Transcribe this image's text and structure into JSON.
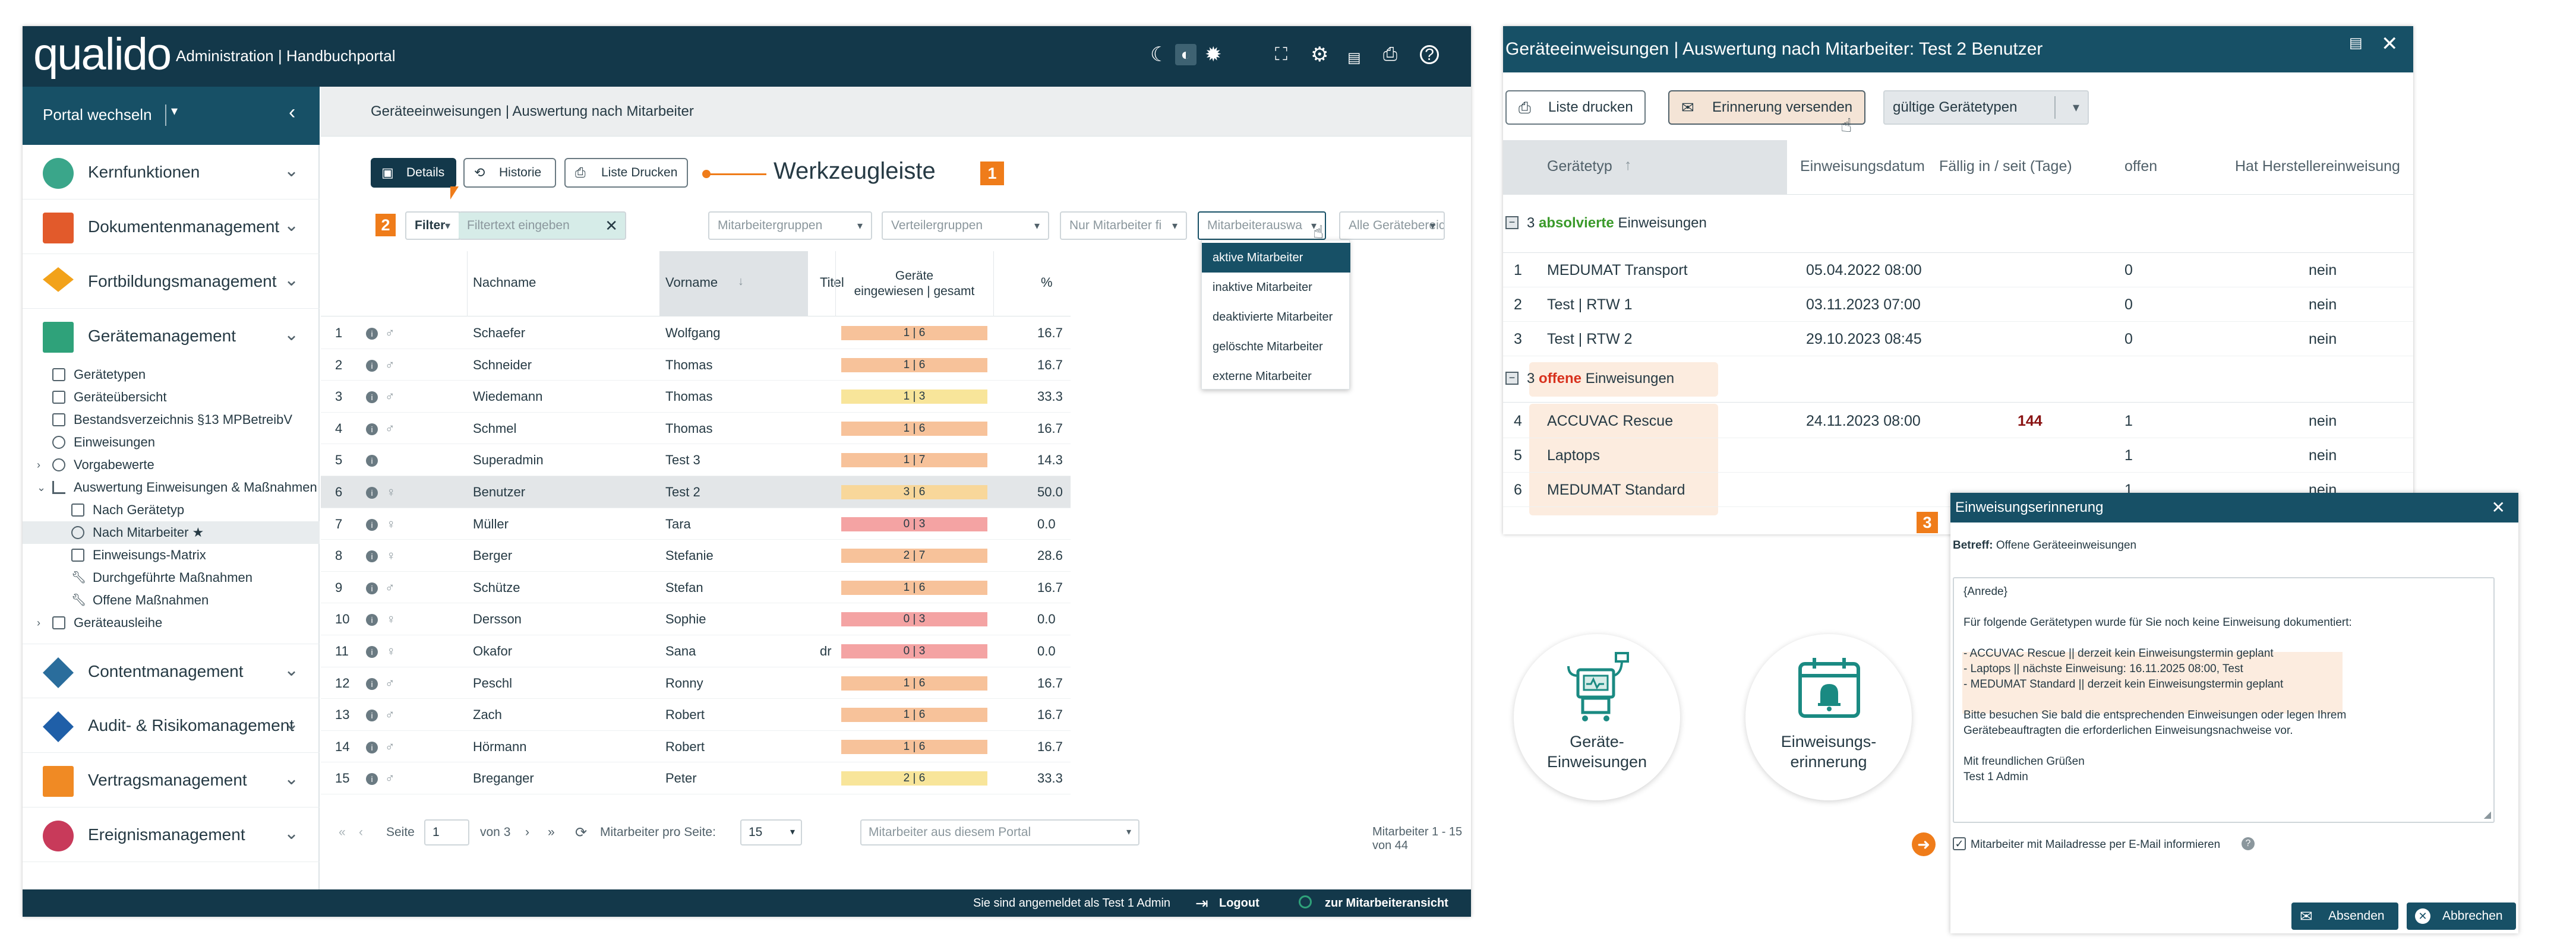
{
  "app": {
    "logo": "qualido",
    "title": "Administration | Handbuchportal",
    "portal_switch": "Portal wechseln"
  },
  "sidebar": {
    "modules": [
      {
        "label": "Kernfunktionen",
        "color": "#3aa68a"
      },
      {
        "label": "Dokumentenmanagement",
        "color": "#e25a2b"
      },
      {
        "label": "Fortbildungsmanagement",
        "color": "#f2a21a"
      },
      {
        "label": "Gerätemanagement",
        "color": "#2fa27a"
      },
      {
        "label": "Contentmanagement",
        "color": "#2a6d9c"
      },
      {
        "label": "Audit- & Risikomanagement",
        "color": "#1f5fa8"
      },
      {
        "label": "Vertragsmanagement",
        "color": "#f08a24"
      },
      {
        "label": "Ereignismanagement",
        "color": "#c83a5a"
      }
    ],
    "sub_items": [
      "Gerätetypen",
      "Geräteübersicht",
      "Bestandsverzeichnis §13 MPBetreibV",
      "Einweisungen",
      "Vorgabewerte",
      "Auswertung Einweisungen & Maßnahmen",
      "Nach Gerätetyp",
      "Nach Mitarbeiter ★",
      "Einweisungs-Matrix",
      "Durchgeführte Maßnahmen",
      "Offene Maßnahmen",
      "Geräteausleihe"
    ]
  },
  "main": {
    "breadcrumb": "Geräteeinweisungen | Auswertung nach Mitarbeiter",
    "toolbar": {
      "details": "Details",
      "historie": "Historie",
      "print": "Liste Drucken",
      "annotation": "Werkzeugleiste",
      "annotation_num": "1"
    },
    "filter": {
      "num": "2",
      "label": "Filter",
      "placeholder": "Filtertext eingeben",
      "mitarbeitergruppen": "Mitarbeitergruppen",
      "verteilergruppen": "Verteilergruppen",
      "nur_mitarbeiter": "Nur Mitarbeiter fi",
      "mitarbeiterauswahl": "Mitarbeiterauswa",
      "geraetebereiche": "Alle Gerätebereiche"
    },
    "dropdown_options": [
      "aktive Mitarbeiter",
      "inaktive Mitarbeiter",
      "deaktivierte Mitarbeiter",
      "gelöschte Mitarbeiter",
      "externe Mitarbeiter"
    ],
    "table": {
      "headers": {
        "nachname": "Nachname",
        "vorname": "Vorname",
        "titel": "Titel",
        "geraete1": "Geräte",
        "geraete2": "eingewiesen | gesamt",
        "pct": "%"
      },
      "rows": [
        {
          "n": "1",
          "nachname": "Schaefer",
          "vorname": "Wolfgang",
          "titel": "",
          "bar": "1 | 6",
          "pct": "16.7",
          "color": "#f7c29a",
          "gender": "m"
        },
        {
          "n": "2",
          "nachname": "Schneider",
          "vorname": "Thomas",
          "titel": "",
          "bar": "1 | 6",
          "pct": "16.7",
          "color": "#f7c29a",
          "gender": "m"
        },
        {
          "n": "3",
          "nachname": "Wiedemann",
          "vorname": "Thomas",
          "titel": "",
          "bar": "1 | 3",
          "pct": "33.3",
          "color": "#f8e59a",
          "gender": "m"
        },
        {
          "n": "4",
          "nachname": "Schmel",
          "vorname": "Thomas",
          "titel": "",
          "bar": "1 | 6",
          "pct": "16.7",
          "color": "#f7c29a",
          "gender": "m"
        },
        {
          "n": "5",
          "nachname": "Superadmin",
          "vorname": "Test 3",
          "titel": "",
          "bar": "1 | 7",
          "pct": "14.3",
          "color": "#f7c29a",
          "gender": ""
        },
        {
          "n": "6",
          "nachname": "Benutzer",
          "vorname": "Test 2",
          "titel": "",
          "bar": "3 | 6",
          "pct": "50.0",
          "color": "#f8d79a",
          "gender": "f"
        },
        {
          "n": "7",
          "nachname": "Müller",
          "vorname": "Tara",
          "titel": "",
          "bar": "0 | 3",
          "pct": "0.0",
          "color": "#f4a3a3",
          "gender": "f"
        },
        {
          "n": "8",
          "nachname": "Berger",
          "vorname": "Stefanie",
          "titel": "",
          "bar": "2 | 7",
          "pct": "28.6",
          "color": "#f7c29a",
          "gender": "f"
        },
        {
          "n": "9",
          "nachname": "Schütze",
          "vorname": "Stefan",
          "titel": "",
          "bar": "1 | 6",
          "pct": "16.7",
          "color": "#f7c29a",
          "gender": "m"
        },
        {
          "n": "10",
          "nachname": "Dersson",
          "vorname": "Sophie",
          "titel": "",
          "bar": "0 | 3",
          "pct": "0.0",
          "color": "#f4a3a3",
          "gender": "f"
        },
        {
          "n": "11",
          "nachname": "Okafor",
          "vorname": "Sana",
          "titel": "dr",
          "bar": "0 | 3",
          "pct": "0.0",
          "color": "#f4a3a3",
          "gender": "f"
        },
        {
          "n": "12",
          "nachname": "Peschl",
          "vorname": "Ronny",
          "titel": "",
          "bar": "1 | 6",
          "pct": "16.7",
          "color": "#f7c29a",
          "gender": "m"
        },
        {
          "n": "13",
          "nachname": "Zach",
          "vorname": "Robert",
          "titel": "",
          "bar": "1 | 6",
          "pct": "16.7",
          "color": "#f7c29a",
          "gender": "m"
        },
        {
          "n": "14",
          "nachname": "Hörmann",
          "vorname": "Robert",
          "titel": "",
          "bar": "1 | 6",
          "pct": "16.7",
          "color": "#f7c29a",
          "gender": "m"
        },
        {
          "n": "15",
          "nachname": "Breganger",
          "vorname": "Peter",
          "titel": "",
          "bar": "2 | 6",
          "pct": "33.3",
          "color": "#f8e59a",
          "gender": "m"
        }
      ]
    },
    "pagination": {
      "seite": "Seite",
      "page": "1",
      "von": "von 3",
      "per_page_label": "Mitarbeiter pro Seite:",
      "per_page": "15",
      "portal_select": "Mitarbeiter aus diesem Portal",
      "summary": "Mitarbeiter 1 - 15 von 44"
    }
  },
  "footer": {
    "logged_in": "Sie sind angemeldet als Test 1 Admin",
    "logout": "Logout",
    "employee_view": "zur Mitarbeiteransicht"
  },
  "right_panel": {
    "title": "Geräteeinweisungen | Auswertung nach Mitarbeiter: Test 2 Benutzer",
    "print": "Liste drucken",
    "reminder": "Erinnerung versenden",
    "types_select": "gültige Gerätetypen",
    "headers": {
      "typ": "Gerätetyp",
      "datum": "Einweisungsdatum",
      "faellig": "Fällig in / seit (Tage)",
      "offen": "offen",
      "hersteller": "Hat Herstellereinweisung"
    },
    "group1": {
      "count": "3",
      "status": "absolvierte",
      "rest": "Einweisungen"
    },
    "group2": {
      "count": "3",
      "status": "offene",
      "rest": "Einweisungen"
    },
    "done_rows": [
      {
        "n": "1",
        "typ": "MEDUMAT Transport",
        "datum": "05.04.2022 08:00",
        "faellig": "",
        "offen": "0",
        "hersteller": "nein"
      },
      {
        "n": "2",
        "typ": "Test | RTW 1",
        "datum": "03.11.2023 07:00",
        "faellig": "",
        "offen": "0",
        "hersteller": "nein"
      },
      {
        "n": "3",
        "typ": "Test | RTW 2",
        "datum": "29.10.2023 08:45",
        "faellig": "",
        "offen": "0",
        "hersteller": "nein"
      }
    ],
    "open_rows": [
      {
        "n": "4",
        "typ": "ACCUVAC Rescue",
        "datum": "24.11.2023 08:00",
        "faellig": "144",
        "offen": "1",
        "hersteller": "nein"
      },
      {
        "n": "5",
        "typ": "Laptops",
        "datum": "",
        "faellig": "",
        "offen": "1",
        "hersteller": "nein"
      },
      {
        "n": "6",
        "typ": "MEDUMAT Standard",
        "datum": "",
        "faellig": "",
        "offen": "1",
        "hersteller": "nein"
      }
    ]
  },
  "circles": [
    {
      "line1": "Geräte-",
      "line2": "Einweisungen"
    },
    {
      "line1": "Einweisungs-",
      "line2": "erinnerung"
    }
  ],
  "dialog": {
    "num": "3",
    "title": "Einweisungserinnerung",
    "betreff_label": "Betreff:",
    "betreff": "Offene Geräteeinweisungen",
    "body": [
      "{Anrede}",
      "",
      "Für folgende Gerätetypen wurde für Sie noch keine Einweisung dokumentiert:",
      "",
      "- ACCUVAC Rescue || derzeit kein Einweisungstermin geplant",
      "- Laptops || nächste Einweisung: 16.11.2025 08:00, Test",
      "- MEDUMAT Standard || derzeit kein Einweisungstermin geplant",
      "",
      "Bitte besuchen Sie bald die entsprechenden Einweisungen oder legen Ihrem",
      "Gerätebeauftragten die erforderlichen Einweisungsnachweise vor.",
      "",
      "Mit freundlichen Grüßen",
      "Test 1 Admin"
    ],
    "checkbox": "Mitarbeiter mit Mailadresse per E-Mail informieren",
    "send": "Absenden",
    "cancel": "Abbrechen"
  },
  "colors": {
    "dark": "#13384a",
    "accent": "#ef7c1a",
    "teal": "#1a8a82"
  }
}
